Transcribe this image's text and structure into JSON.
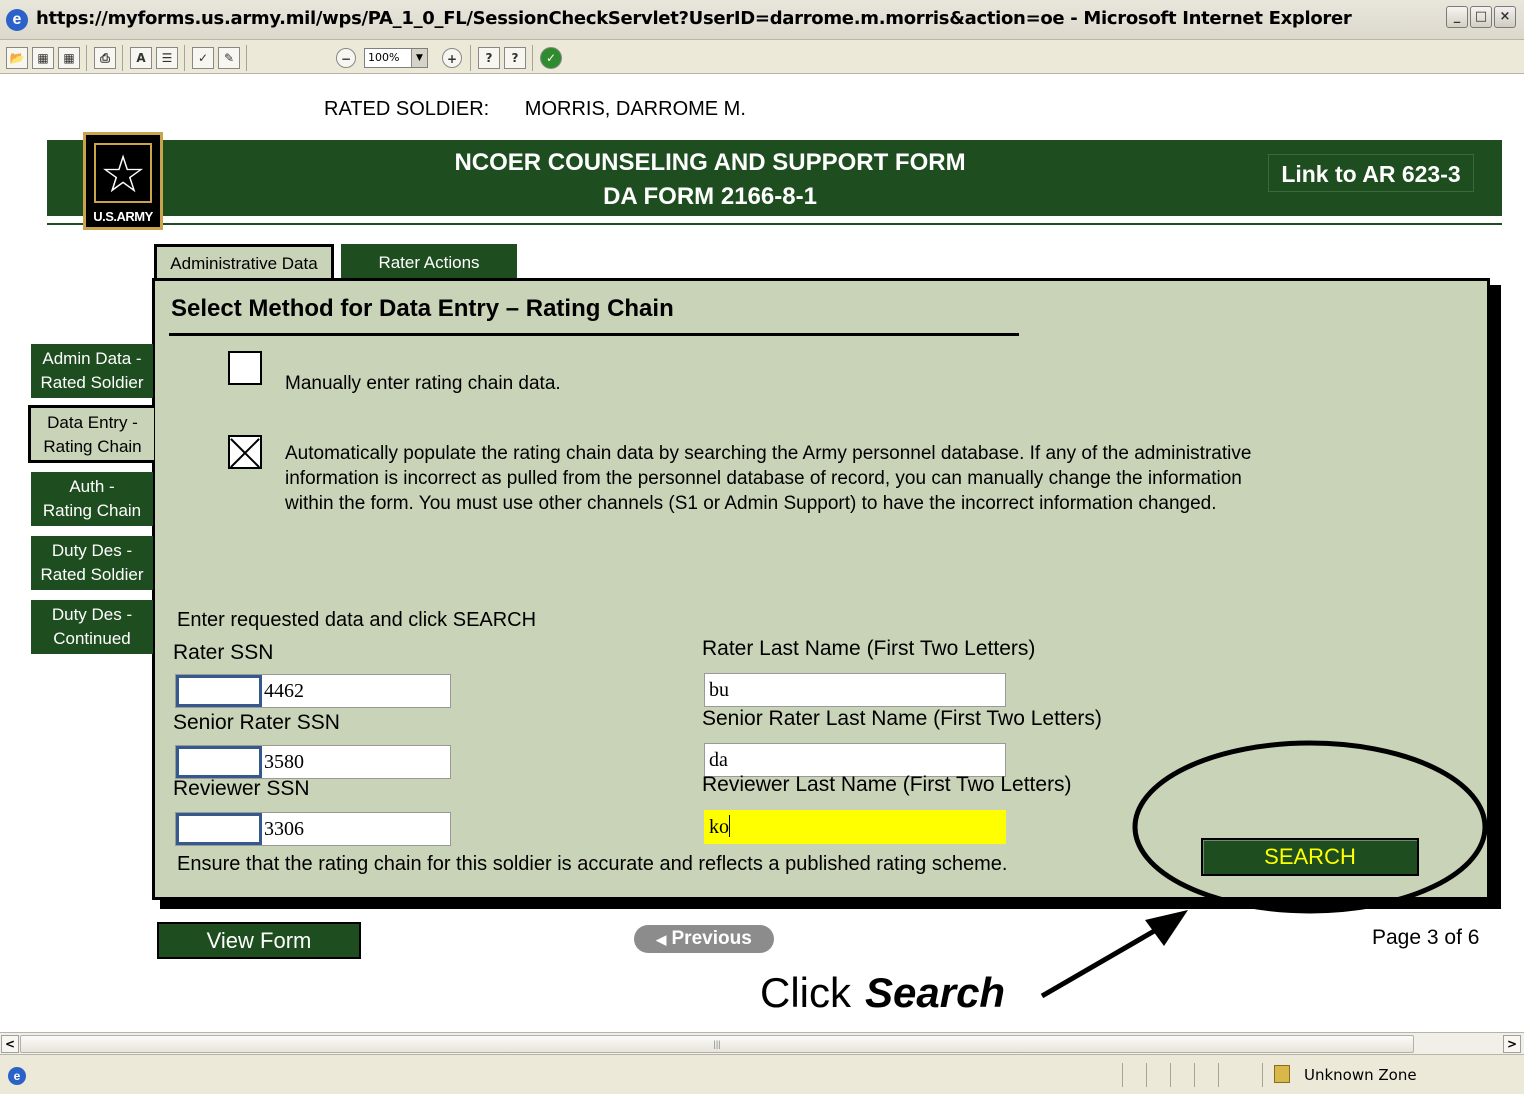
{
  "window": {
    "title": "https://myforms.us.army.mil/wps/PA_1_0_FL/SessionCheckServlet?UserID=darrome.m.morris&action=oe - Microsoft Internet Explorer"
  },
  "toolbar": {
    "zoom": "100%",
    "icons": [
      "open-icon",
      "save-icon",
      "save-as-icon",
      "print-icon",
      "text-icon",
      "form-icon",
      "spellcheck-icon",
      "signature-icon",
      "zoom-out-icon",
      "zoom-in-icon",
      "whats-this-icon",
      "help-icon",
      "about-icon"
    ]
  },
  "header": {
    "rated_soldier_label": "RATED SOLDIER:",
    "rated_soldier_name": "MORRIS, DARROME M.",
    "logo_text": "U.S.ARMY",
    "title_line1": "NCOER COUNSELING AND SUPPORT FORM",
    "title_line2": "DA FORM 2166-8-1",
    "link_ar": "Link to AR 623-3"
  },
  "tabs": [
    {
      "label": "Administrative Data",
      "active": true
    },
    {
      "label": "Rater Actions",
      "active": false
    }
  ],
  "sidebar": [
    {
      "line1": "Admin Data -",
      "line2": "Rated Soldier",
      "active": false
    },
    {
      "line1": "Data Entry -",
      "line2": "Rating Chain",
      "active": true
    },
    {
      "line1": "Auth -",
      "line2": "Rating Chain",
      "active": false
    },
    {
      "line1": "Duty Des -",
      "line2": "Rated Soldier",
      "active": false
    },
    {
      "line1": "Duty Des -",
      "line2": "Continued",
      "active": false
    }
  ],
  "panel": {
    "heading": "Select Method for Data Entry – Rating Chain",
    "option_manual": {
      "label": "Manually enter rating chain data.",
      "checked": false
    },
    "option_auto": {
      "label": "Automatically populate the rating chain data by searching the Army personnel database.  If any of the administrative information is incorrect as pulled from the personnel database of record, you can manually change the information within the form. You must use other channels (S1 or Admin Support) to have the incorrect information changed.",
      "checked": true
    },
    "instructions": "Enter requested data and click SEARCH",
    "rater_ssn_label": "Rater SSN",
    "rater_ssn_value": "4462",
    "rater_name_label": "Rater Last Name (First Two Letters)",
    "rater_name_value": "bu",
    "senior_ssn_label": "Senior Rater SSN",
    "senior_ssn_value": "3580",
    "senior_name_label": "Senior Rater Last Name (First Two Letters)",
    "senior_name_value": "da",
    "reviewer_ssn_label": "Reviewer SSN",
    "reviewer_ssn_value": "3306",
    "reviewer_name_label": "Reviewer Last Name (First Two Letters)",
    "reviewer_name_value": "ko",
    "ensure_text": "Ensure that the rating chain for this soldier is accurate and reflects a published rating scheme.",
    "search_button": "SEARCH"
  },
  "footer": {
    "view_form": "View Form",
    "previous": "Previous",
    "page_status": "Page 3 of 6"
  },
  "annotation": {
    "prefix": "Click",
    "emphasis": "Search"
  },
  "statusbar": {
    "zone": "Unknown Zone"
  }
}
